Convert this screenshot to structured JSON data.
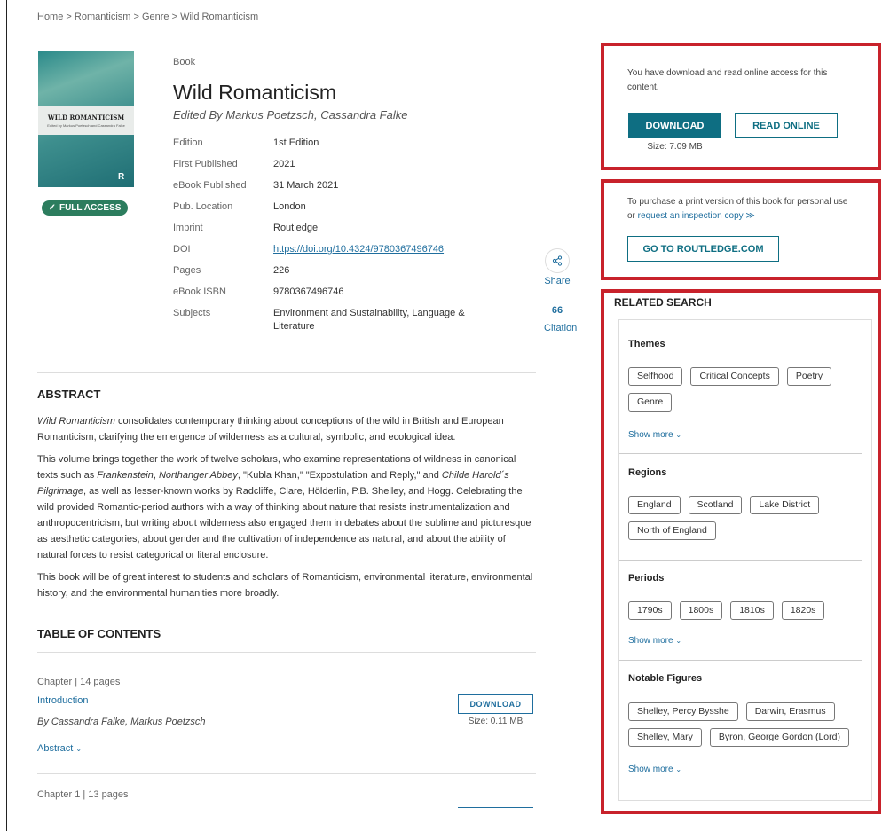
{
  "breadcrumb": "Home > Romanticism > Genre > Wild Romanticism",
  "cover": {
    "title": "WILD ROMANTICISM",
    "subtitle": "Edited by Markus Poetzsch and Cassandra Falke",
    "publisher_mark": "R"
  },
  "badge": {
    "check": "✓",
    "label": "FULL ACCESS"
  },
  "book": {
    "type": "Book",
    "title": "Wild Romanticism",
    "editors_prefix": "Edited By",
    "editors": "Markus Poetzsch, Cassandra Falke"
  },
  "meta": [
    {
      "key": "Edition",
      "value": "1st Edition"
    },
    {
      "key": "First Published",
      "value": "2021"
    },
    {
      "key": "eBook Published",
      "value": "31 March 2021"
    },
    {
      "key": "Pub. Location",
      "value": "London"
    },
    {
      "key": "Imprint",
      "value": "Routledge"
    },
    {
      "key": "DOI",
      "value": "https://doi.org/10.4324/9780367496746"
    },
    {
      "key": "Pages",
      "value": "226"
    },
    {
      "key": "eBook ISBN",
      "value": "9780367496746"
    },
    {
      "key": "Subjects",
      "value": "Environment and Sustainability, Language & Literature"
    }
  ],
  "share": {
    "icon": "share-icon",
    "label": "Share"
  },
  "citation": {
    "icon": "66",
    "label": "Citation"
  },
  "abstract": {
    "heading": "ABSTRACT",
    "p1_title": "Wild Romanticism",
    "p1_rest": " consolidates contemporary thinking about conceptions of the wild in British and European Romanticism, clarifying the emergence of wilderness as a cultural, symbolic, and ecological idea.",
    "p2_a": "This volume brings together the work of twelve scholars, who examine representations of wildness in canonical texts such as ",
    "p2_b": "Frankenstein",
    "p2_c": ", ",
    "p2_d": "Northanger Abbey",
    "p2_e": ", \"Kubla Khan,\" \"Expostulation and Reply,\" and ",
    "p2_f": "Childe Harold´s Pilgrimage",
    "p2_g": ", as well as lesser-known works by Radcliffe, Clare, Hölderlin, P.B. Shelley, and Hogg. Celebrating the wild provided Romantic-period authors with a way of thinking about nature that resists instrumentalization and anthropocentricism, but writing about wilderness also engaged them in debates about the sublime and picturesque as aesthetic categories, about gender and the cultivation of independence as natural, and about the ability of natural forces to resist categorical or literal enclosure.",
    "p3": "This book will be of great interest to students and scholars of Romanticism, environmental literature, environmental history, and the environmental humanities more broadly."
  },
  "toc": {
    "heading": "TABLE OF CONTENTS",
    "items": [
      {
        "meta": "Chapter | 14 pages",
        "title": "Introduction",
        "by": "By Cassandra Falke, Markus Poetzsch",
        "abstract_label": "Abstract",
        "download_label": "DOWNLOAD",
        "size": "Size: 0.11 MB"
      },
      {
        "meta": "Chapter 1 | 13 pages"
      }
    ]
  },
  "access_panel": {
    "text": "You have download and read online access for this content.",
    "download_label": "DOWNLOAD",
    "read_label": "READ ONLINE",
    "size": "Size: 7.09 MB"
  },
  "purchase_panel": {
    "text": "To purchase a print version of this book for personal use or ",
    "link": "request an inspection copy",
    "arrows": "≫",
    "button": "GO TO ROUTLEDGE.COM"
  },
  "related": {
    "title": "RELATED SEARCH",
    "show_more": "Show more",
    "sections": [
      {
        "heading": "Themes",
        "tags": [
          "Selfhood",
          "Critical Concepts",
          "Poetry",
          "Genre"
        ]
      },
      {
        "heading": "Regions",
        "tags": [
          "England",
          "Scotland",
          "Lake District",
          "North of England"
        ]
      },
      {
        "heading": "Periods",
        "tags": [
          "1790s",
          "1800s",
          "1810s",
          "1820s"
        ]
      },
      {
        "heading": "Notable Figures",
        "tags": [
          "Shelley, Percy Bysshe",
          "Darwin, Erasmus",
          "Shelley, Mary",
          "Byron, George Gordon (Lord)"
        ]
      }
    ]
  },
  "colors": {
    "teal": "#0e6e82",
    "link": "#1f6e9e",
    "highlight": "#c8222b",
    "badge": "#2c7d5e"
  }
}
